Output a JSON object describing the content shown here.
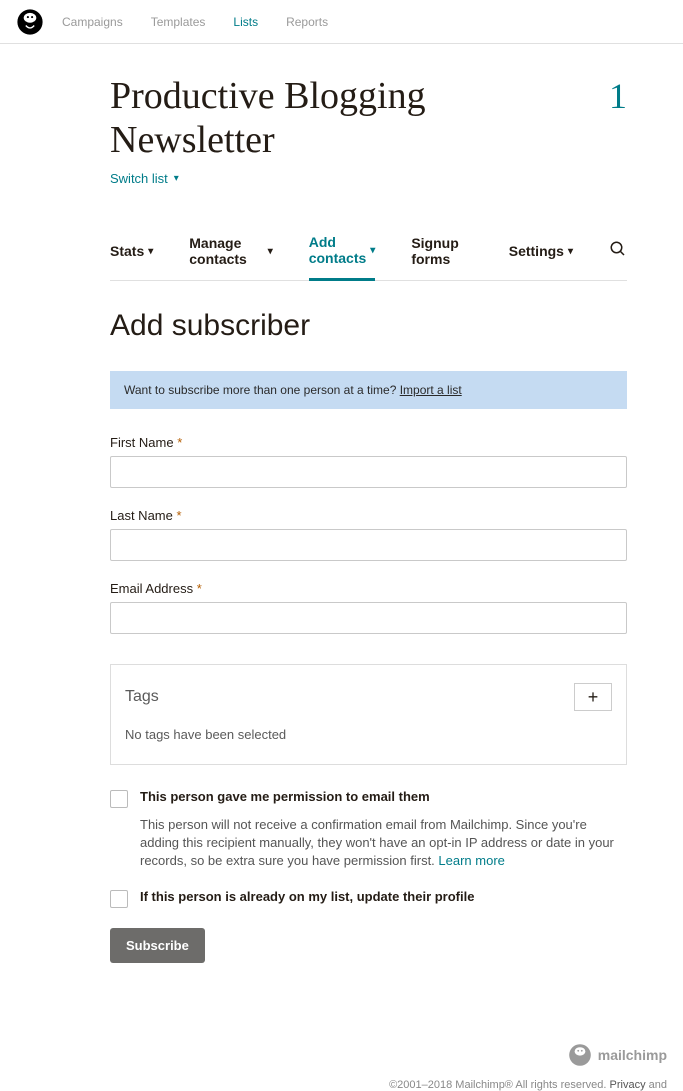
{
  "topnav": {
    "items": [
      {
        "label": "Campaigns"
      },
      {
        "label": "Templates"
      },
      {
        "label": "Lists"
      },
      {
        "label": "Reports"
      }
    ]
  },
  "page": {
    "title": "Productive Blogging Newsletter",
    "count": "1",
    "switch_list": "Switch list"
  },
  "tabs": {
    "stats": "Stats",
    "manage": "Manage contacts",
    "add": "Add contacts",
    "signup": "Signup forms",
    "settings": "Settings"
  },
  "heading": "Add subscriber",
  "notice": {
    "text": "Want to subscribe more than one person at a time? ",
    "link": "Import a list"
  },
  "fields": {
    "first_name": "First Name",
    "last_name": "Last Name",
    "email": "Email Address"
  },
  "tags": {
    "title": "Tags",
    "add": "+",
    "empty": "No tags have been selected"
  },
  "permission": {
    "label": "This person gave me permission to email them",
    "desc": "This person will not receive a confirmation email from Mailchimp. Since you're adding this recipient manually, they won't have an opt-in IP address or date in your records, so be extra sure you have permission first. ",
    "learn": "Learn more"
  },
  "update": {
    "label": "If this person is already on my list, update their profile"
  },
  "submit": "Subscribe",
  "footer": {
    "brand": "mailchimp",
    "copyright": "©2001–2018 Mailchimp® All rights reserved. ",
    "privacy": "Privacy",
    "and": " and"
  }
}
